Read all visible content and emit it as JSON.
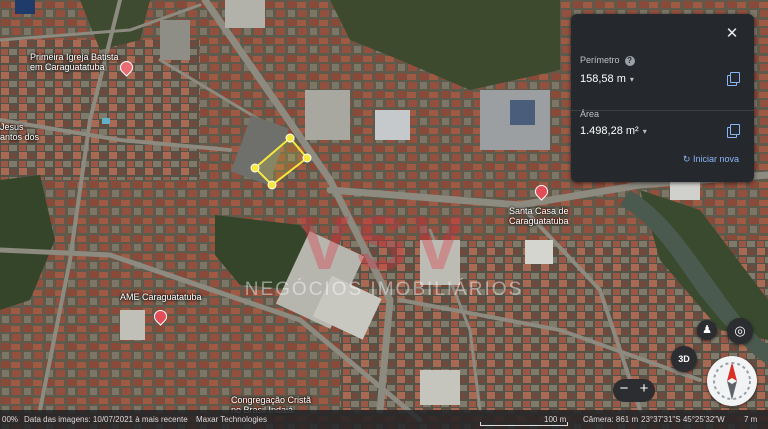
{
  "map": {
    "places": {
      "primeira_igreja": "Primeira Igreja Batista\nem Caraguatatuba",
      "jesus": "Jesus\nantos dos",
      "ame": "AME Caraguatatuba",
      "santa_casa": "Santa Casa de\nCaraguatatuba",
      "congregacao": "Congregação Cristã\nno Brasil Indaiá"
    },
    "watermark_main": "VSV",
    "watermark_sub": "NEGÓCIOS IMOBILIÁRIOS",
    "measure_color": "#f6e83c"
  },
  "panel": {
    "perimeter_label": "Perímetro",
    "perimeter_value": "158,58 m",
    "area_label": "Área",
    "area_value": "1.498,28 m²",
    "restart_label": "Iniciar nova",
    "close_icon": "close-icon",
    "copy_icon": "copy-icon"
  },
  "controls": {
    "three_d_label": "3D",
    "zoom_in": "+",
    "zoom_out": "−"
  },
  "bottom_bar": {
    "left_zoom": "00%",
    "imagery_date": "Data das imagens: 10/07/2021 à mais recente",
    "provider": "Maxar Technologies",
    "scale_label": "100 m",
    "camera": "Câmera: 861 m",
    "coords": "23°37'31\"S 45°25'32\"W",
    "elevation": "7 m"
  }
}
